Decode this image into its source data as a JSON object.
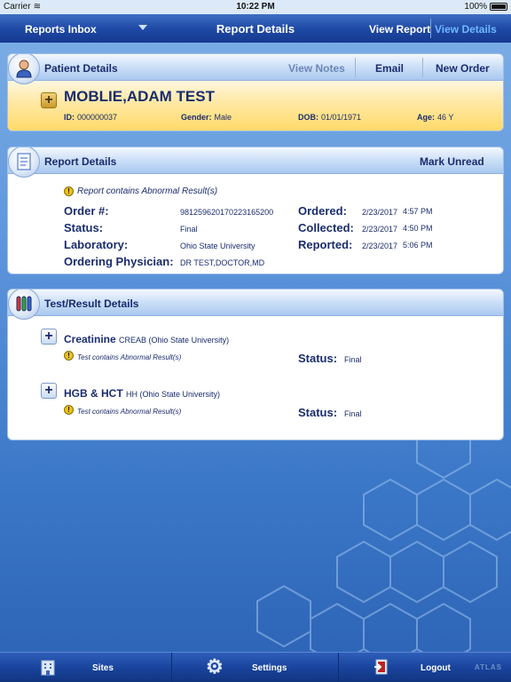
{
  "status_bar": {
    "carrier": "Carrier",
    "time": "10:22 PM",
    "battery": "100%"
  },
  "navbar": {
    "inbox_label": "Reports Inbox",
    "title": "Report Details",
    "view_report": "View Report",
    "view_details": "View Details"
  },
  "patient_panel": {
    "title": "Patient Details",
    "actions": {
      "view_notes": "View Notes",
      "email": "Email",
      "new_order": "New Order"
    },
    "name": "MOBLIE,ADAM TEST",
    "fields": {
      "id_label": "ID:",
      "id_value": "000000037",
      "gender_label": "Gender:",
      "gender_value": "Male",
      "dob_label": "DOB:",
      "dob_value": "01/01/1971",
      "age_label": "Age:",
      "age_value": "46 Y"
    }
  },
  "report_panel": {
    "title": "Report Details",
    "mark_unread": "Mark Unread",
    "abnormal_note": "Report contains Abnormal Result(s)",
    "order_label": "Order #:",
    "order_value": "98125962017022316520​0",
    "status_label": "Status:",
    "status_value": "Final",
    "lab_label": "Laboratory:",
    "lab_value": "Ohio State University",
    "physician_label": "Ordering Physician:",
    "physician_value": "DR TEST,DOCTOR,MD",
    "ordered_label": "Ordered:",
    "ordered_date": "2/23/2017",
    "ordered_time": "4:57 PM",
    "collected_label": "Collected:",
    "collected_date": "2/23/2017",
    "collected_time": "4:50 PM",
    "reported_label": "Reported:",
    "reported_date": "2/23/2017",
    "reported_time": "5:06 PM"
  },
  "tests_panel": {
    "title": "Test/Result Details",
    "tests": [
      {
        "name": "Creatinine",
        "code": "CREAB (Ohio State University)",
        "note": "Test contains Abnormal Result(s)",
        "status_label": "Status:",
        "status_value": "Final"
      },
      {
        "name": "HGB & HCT",
        "code": "HH (Ohio State University)",
        "note": "Test contains Abnormal Result(s)",
        "status_label": "Status:",
        "status_value": "Final"
      }
    ]
  },
  "tabbar": {
    "sites": "Sites",
    "settings": "Settings",
    "logout": "Logout",
    "watermark": "ATLAS"
  },
  "colors": {
    "nav_dark": "#15398f",
    "accent_link": "#6fb8ff",
    "patient_highlight": "#ffd966",
    "text_navy": "#1a2c6e"
  },
  "icons": {
    "patient": "person-icon",
    "report": "document-icon",
    "tests": "test-tubes-icon",
    "sites": "building-icon",
    "settings": "gear-icon",
    "logout": "logout-door-icon",
    "expand": "plus-icon",
    "warning": "warning-icon"
  }
}
